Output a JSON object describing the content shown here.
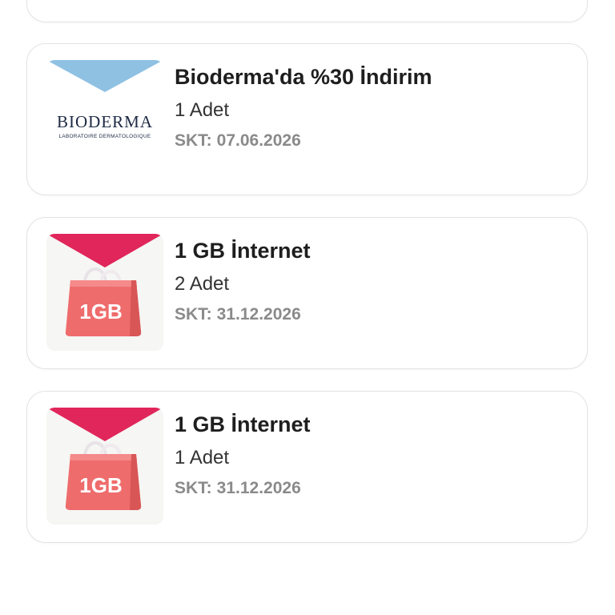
{
  "offers": [
    {
      "brand": "bioderma",
      "logo_text": "BIODERMA",
      "logo_subtext": "LABORATOIRE DERMATOLOGIQUE",
      "title": "Bioderma'da %30 İndirim",
      "quantity": "1 Adet",
      "expiry_label": "SKT:",
      "expiry_date": "07.06.2026",
      "accent_color": "#8fc1e3"
    },
    {
      "brand": "internet",
      "logo_text": "1GB",
      "title": "1 GB İnternet",
      "quantity": "2 Adet",
      "expiry_label": "SKT:",
      "expiry_date": "31.12.2026",
      "accent_color": "#e0265a"
    },
    {
      "brand": "internet",
      "logo_text": "1GB",
      "title": "1 GB İnternet",
      "quantity": "1 Adet",
      "expiry_label": "SKT:",
      "expiry_date": "31.12.2026",
      "accent_color": "#e0265a"
    }
  ]
}
